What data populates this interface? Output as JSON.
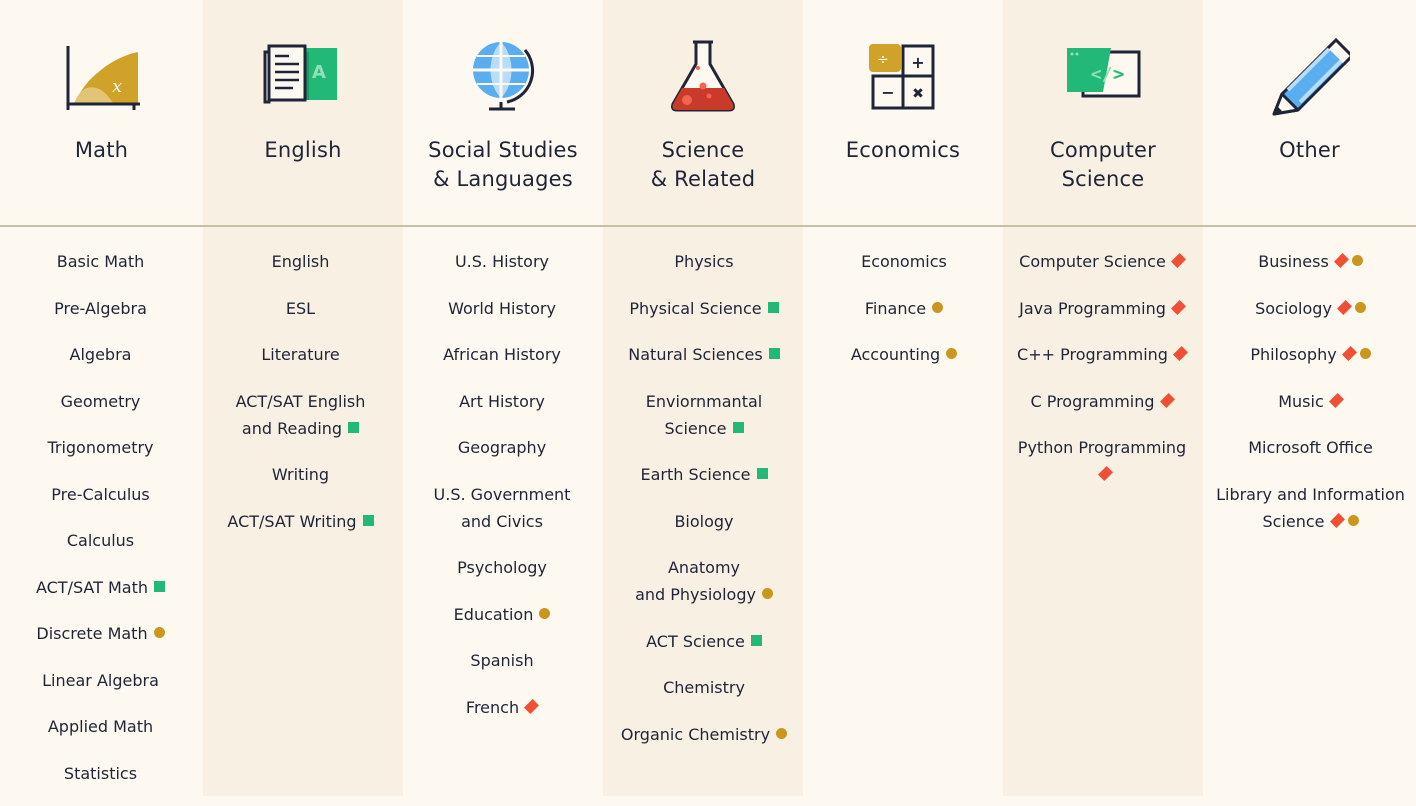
{
  "colors": {
    "background": "#fdf9f0",
    "shaded": "#f8f1e3",
    "green_square": "#22b877",
    "gold_circle": "#c9971f",
    "red_diamond": "#f04e35",
    "text": "#1e2538",
    "divider": "#c8c0a4"
  },
  "columns": [
    {
      "id": "math",
      "title_l1": "Math",
      "title_l2": "",
      "icon": "math-graph-icon",
      "items": [
        {
          "label": "Basic Math"
        },
        {
          "label": "Pre-Algebra"
        },
        {
          "label": "Algebra"
        },
        {
          "label": "Geometry"
        },
        {
          "label": "Trigonometry"
        },
        {
          "label": "Pre-Calculus"
        },
        {
          "label": "Calculus"
        },
        {
          "label": "ACT/SAT Math",
          "markers": [
            "green-square"
          ]
        },
        {
          "label": "Discrete Math",
          "markers": [
            "gold-circle"
          ]
        },
        {
          "label": "Linear Algebra"
        },
        {
          "label": "Applied Math"
        },
        {
          "label": "Statistics"
        }
      ]
    },
    {
      "id": "english",
      "title_l1": "English",
      "title_l2": "",
      "icon": "book-icon",
      "items": [
        {
          "label": "English"
        },
        {
          "label": "ESL"
        },
        {
          "label": "Literature"
        },
        {
          "label": "ACT/SAT English",
          "label2": "and Reading",
          "markers": [
            "green-square"
          ]
        },
        {
          "label": "Writing"
        },
        {
          "label": "ACT/SAT Writing",
          "markers": [
            "green-square"
          ]
        }
      ]
    },
    {
      "id": "social",
      "title_l1": "Social Studies",
      "title_l2": "& Languages",
      "icon": "globe-icon",
      "items": [
        {
          "label": "U.S. History"
        },
        {
          "label": "World History"
        },
        {
          "label": "African History"
        },
        {
          "label": "Art History"
        },
        {
          "label": "Geography"
        },
        {
          "label": "U.S. Government",
          "label2": "and Civics"
        },
        {
          "label": "Psychology"
        },
        {
          "label": "Education",
          "markers": [
            "gold-circle"
          ]
        },
        {
          "label": "Spanish"
        },
        {
          "label": "French",
          "markers": [
            "red-diamond"
          ]
        }
      ]
    },
    {
      "id": "science",
      "title_l1": "Science",
      "title_l2": "& Related",
      "icon": "flask-icon",
      "items": [
        {
          "label": "Physics"
        },
        {
          "label": "Physical Science",
          "markers": [
            "green-square"
          ]
        },
        {
          "label": "Natural Sciences",
          "markers": [
            "green-square"
          ]
        },
        {
          "label": "Enviornmantal",
          "label2": "Science",
          "markers": [
            "green-square"
          ]
        },
        {
          "label": "Earth Science",
          "markers": [
            "green-square"
          ]
        },
        {
          "label": "Biology"
        },
        {
          "label": "Anatomy",
          "label2": "and Physiology",
          "markers": [
            "gold-circle"
          ]
        },
        {
          "label": "ACT Science",
          "markers": [
            "green-square"
          ]
        },
        {
          "label": "Chemistry"
        },
        {
          "label": "Organic Chemistry",
          "markers": [
            "gold-circle"
          ]
        }
      ]
    },
    {
      "id": "economics",
      "title_l1": "Economics",
      "title_l2": "",
      "icon": "calculator-icon",
      "items": [
        {
          "label": "Economics"
        },
        {
          "label": "Finance",
          "markers": [
            "gold-circle"
          ]
        },
        {
          "label": "Accounting",
          "markers": [
            "gold-circle"
          ]
        }
      ]
    },
    {
      "id": "cs",
      "title_l1": "Computer",
      "title_l2": "Science",
      "icon": "code-window-icon",
      "items": [
        {
          "label": "Computer Science",
          "markers": [
            "red-diamond"
          ]
        },
        {
          "label": "Java Programming",
          "markers": [
            "red-diamond"
          ]
        },
        {
          "label": "C++ Programming",
          "markers": [
            "red-diamond"
          ]
        },
        {
          "label": "C Programming",
          "markers": [
            "red-diamond"
          ]
        },
        {
          "label": "Python Programming",
          "markers": [
            "red-diamond"
          ]
        }
      ]
    },
    {
      "id": "other",
      "title_l1": "Other",
      "title_l2": "",
      "icon": "pencil-icon",
      "items": [
        {
          "label": "Business",
          "markers": [
            "red-diamond",
            "gold-circle"
          ]
        },
        {
          "label": "Sociology",
          "markers": [
            "red-diamond",
            "gold-circle"
          ]
        },
        {
          "label": "Philosophy",
          "markers": [
            "red-diamond",
            "gold-circle"
          ]
        },
        {
          "label": "Music",
          "markers": [
            "red-diamond"
          ]
        },
        {
          "label": "Microsoft Office"
        },
        {
          "label": "Library and Information",
          "label2": "Science",
          "markers": [
            "red-diamond",
            "gold-circle"
          ]
        }
      ]
    }
  ]
}
